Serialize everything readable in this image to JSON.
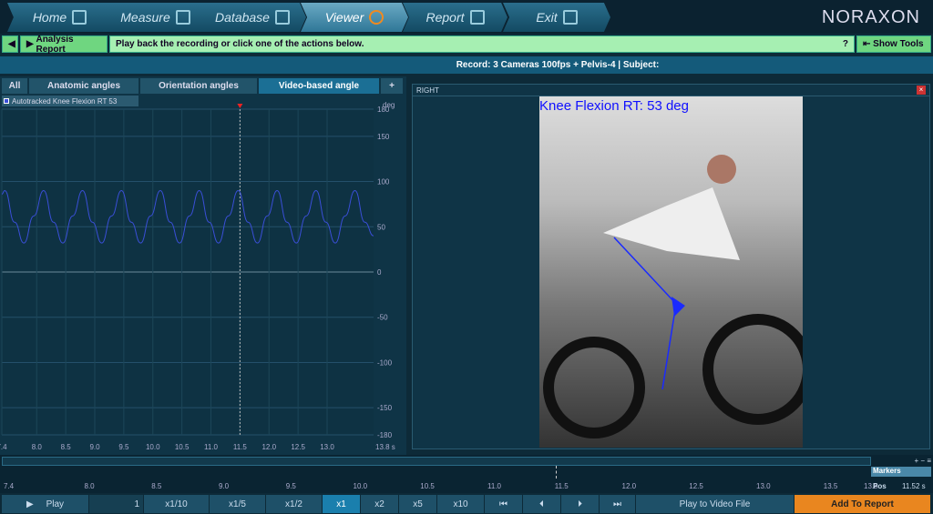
{
  "nav": {
    "tabs": [
      {
        "label": "Home",
        "icon": "home-icon"
      },
      {
        "label": "Measure",
        "icon": "measure-icon"
      },
      {
        "label": "Database",
        "icon": "database-icon"
      },
      {
        "label": "Viewer",
        "icon": "viewer-icon",
        "active": true
      },
      {
        "label": "Report",
        "icon": "report-icon"
      },
      {
        "label": "Exit",
        "icon": "exit-icon"
      }
    ],
    "logo": "NORAXON"
  },
  "action_bar": {
    "back": "◀",
    "report": "Analysis Report",
    "message": "Play back the recording or click one of the actions below.",
    "help": "?",
    "show_tools": "Show Tools"
  },
  "record": "Record: 3 Cameras 100fps  + Pelvis-4 | Subject:",
  "chart_tabs": [
    "All",
    "Anatomic angles",
    "Orientation angles",
    "Video-based angle",
    "+"
  ],
  "legend": "Autotracked Knee Flexion RT   53",
  "video": {
    "panel_title": "RIGHT",
    "overlay": "Knee Flexion RT: 53 deg"
  },
  "chart_data": {
    "type": "line",
    "ylabel": "deg",
    "ylim": [
      -180,
      180
    ],
    "xlim": [
      7.4,
      13.8
    ],
    "yticks": [
      180,
      150,
      100,
      50,
      0,
      -50,
      -100,
      -150,
      -180
    ],
    "xticks": [
      "7.4",
      "8.0",
      "8.5",
      "9.0",
      "9.5",
      "10.0",
      "10.5",
      "11.0",
      "11.5",
      "12.0",
      "12.5",
      "13.0"
    ],
    "xend_label": "13.8 s",
    "cursor": 11.5,
    "color": "#3a4fd8",
    "series": [
      {
        "name": "Autotracked Knee Flexion RT",
        "x": [
          7.4,
          7.45,
          7.62,
          7.78,
          7.95,
          8.12,
          8.29,
          8.45,
          8.62,
          8.79,
          8.96,
          9.12,
          9.29,
          9.46,
          9.63,
          9.79,
          9.96,
          10.13,
          10.3,
          10.46,
          10.63,
          10.8,
          10.97,
          11.13,
          11.3,
          11.47,
          11.64,
          11.8,
          11.97,
          12.14,
          12.31,
          12.47,
          12.64,
          12.81,
          12.98,
          13.14,
          13.31,
          13.48,
          13.65,
          13.8
        ],
        "y": [
          86,
          90,
          55,
          32,
          62,
          90,
          55,
          32,
          62,
          90,
          55,
          32,
          62,
          90,
          55,
          32,
          62,
          90,
          55,
          32,
          62,
          90,
          55,
          32,
          62,
          90,
          55,
          32,
          62,
          90,
          55,
          32,
          62,
          90,
          55,
          32,
          62,
          90,
          55,
          40
        ]
      }
    ]
  },
  "timeline": {
    "ticks": [
      "7.4",
      "8.0",
      "8.5",
      "9.0",
      "9.5",
      "10.0",
      "10.5",
      "11.0",
      "11.5",
      "12.0",
      "12.5",
      "13.0",
      "13.5",
      "13.8"
    ],
    "markers": "Markers",
    "pos_label": "Pos",
    "pos_value": "11.52 s"
  },
  "controls": {
    "play": "Play",
    "frame": "1",
    "speeds": [
      "x1/10",
      "x1/5",
      "x1/2",
      "x1",
      "x2",
      "x5",
      "x10"
    ],
    "active_speed": "x1",
    "nav": [
      "⏮",
      "⏴",
      "⏵",
      "⏭"
    ],
    "export": "Play to Video File",
    "add": "Add To Report"
  }
}
